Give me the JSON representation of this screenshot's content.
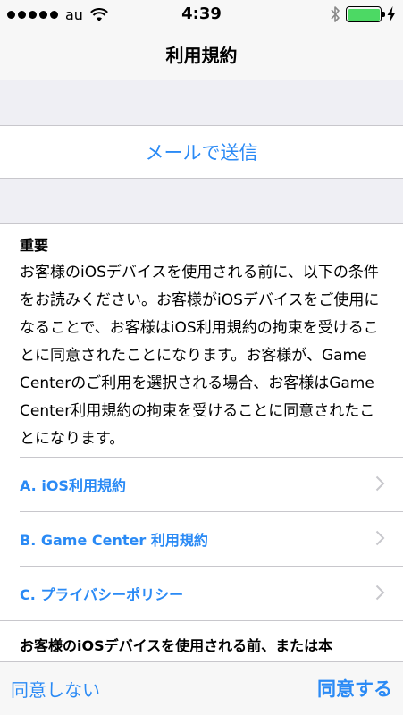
{
  "status_bar": {
    "carrier": "au",
    "time": "4:39",
    "signal_bars": 5,
    "battery_level": 1.0,
    "icons": [
      "signal-dots-icon",
      "wifi-icon",
      "bluetooth-icon",
      "battery-icon",
      "charging-bolt-icon"
    ],
    "battery_color": "#4cd964"
  },
  "nav": {
    "title": "利用規約"
  },
  "mail": {
    "label": "メールで送信"
  },
  "terms": {
    "heading": "重要",
    "body": "お客様のiOSデバイスを使用される前に、以下の条件をお読みください。お客様がiOSデバイスをご使用になることで、お客様はiOS利用規約の拘束を受けることに同意されたことになります。お客様が、Game Centerのご利用を選択される場合、お客様はGame Center利用規約の拘束を受けることに同意されたことになります。"
  },
  "links": [
    {
      "label": "A. iOS利用規約"
    },
    {
      "label": "B. Game Center 利用規約"
    },
    {
      "label": "C. プライバシーポリシー"
    }
  ],
  "bottom": {
    "text": "お客様のiOSデバイスを使用される前、または本"
  },
  "toolbar": {
    "disagree_label": "同意しない",
    "agree_label": "同意する"
  },
  "colors": {
    "accent": "#2a8af5",
    "background": "#efeff4",
    "separator": "#c8c7cc"
  }
}
